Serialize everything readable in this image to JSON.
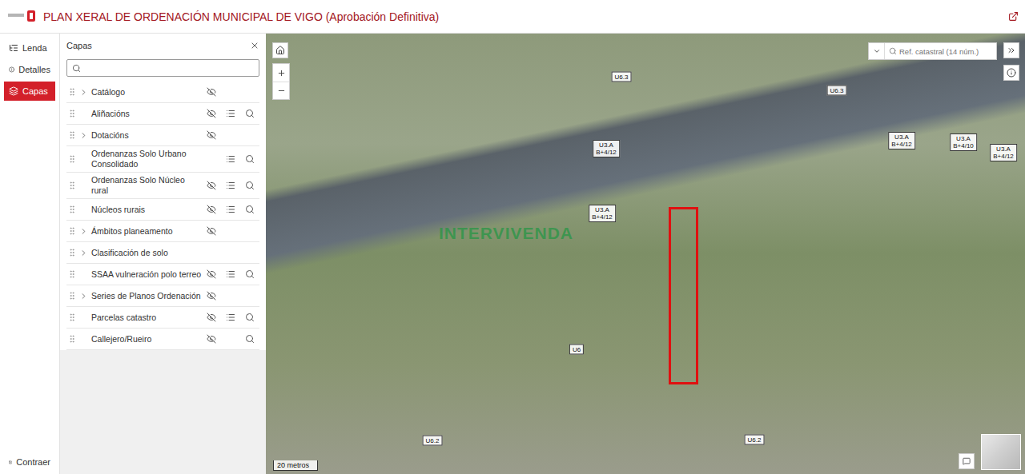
{
  "header": {
    "title": "PLAN XERAL DE ORDENACIÓN MUNICIPAL DE VIGO (Aprobación Definitiva)"
  },
  "rail": {
    "items": [
      {
        "label": "Lenda",
        "selected": false
      },
      {
        "label": "Detalles",
        "selected": false
      },
      {
        "label": "Capas",
        "selected": true
      }
    ],
    "collapse": "Contraer"
  },
  "layers_panel": {
    "title": "Capas",
    "search_placeholder": "",
    "layers": [
      {
        "name": "Catálogo",
        "expandable": true,
        "visible": false,
        "has_legend": false,
        "has_search": false
      },
      {
        "name": "Aliñacións",
        "expandable": false,
        "visible": false,
        "has_legend": true,
        "has_search": true
      },
      {
        "name": "Dotacións",
        "expandable": true,
        "visible": false,
        "has_legend": false,
        "has_search": false
      },
      {
        "name": "Ordenanzas Solo Urbano Consolidado",
        "expandable": false,
        "visible": true,
        "has_legend": true,
        "has_search": true
      },
      {
        "name": "Ordenanzas Solo Núcleo rural",
        "expandable": false,
        "visible": false,
        "has_legend": true,
        "has_search": true
      },
      {
        "name": "Núcleos rurais",
        "expandable": false,
        "visible": false,
        "has_legend": true,
        "has_search": true
      },
      {
        "name": "Ámbitos planeamento",
        "expandable": true,
        "visible": false,
        "has_legend": false,
        "has_search": false
      },
      {
        "name": "Clasificación de solo",
        "expandable": true,
        "visible": true,
        "has_legend": false,
        "has_search": false
      },
      {
        "name": "SSAA vulneración polo terreo",
        "expandable": false,
        "visible": false,
        "has_legend": true,
        "has_search": true
      },
      {
        "name": "Series de Planos Ordenación",
        "expandable": true,
        "visible": false,
        "has_legend": false,
        "has_search": false
      },
      {
        "name": "Parcelas catastro",
        "expandable": false,
        "visible": false,
        "has_legend": true,
        "has_search": true
      },
      {
        "name": "Callejero/Rueiro",
        "expandable": false,
        "visible": false,
        "has_legend": false,
        "has_search": true
      }
    ]
  },
  "map": {
    "search_placeholder": "Ref. catastral (14 núm.)",
    "labels": [
      {
        "lines": [
          "U6.3"
        ]
      },
      {
        "lines": [
          "U6.3"
        ]
      },
      {
        "lines": [
          "U3.A",
          "B+4/12"
        ]
      },
      {
        "lines": [
          "U3.A",
          "B+4/12"
        ]
      },
      {
        "lines": [
          "U3.A",
          "B+4/10"
        ]
      },
      {
        "lines": [
          "U3.A",
          "B+4/12"
        ]
      },
      {
        "lines": [
          "U3.A",
          "B+4/12"
        ]
      },
      {
        "lines": [
          "U6"
        ]
      },
      {
        "lines": [
          "U6.2"
        ]
      },
      {
        "lines": [
          "U6.2"
        ]
      }
    ],
    "watermark": "INTERVIVENDA",
    "highlight": true,
    "scale": "20 metros"
  }
}
